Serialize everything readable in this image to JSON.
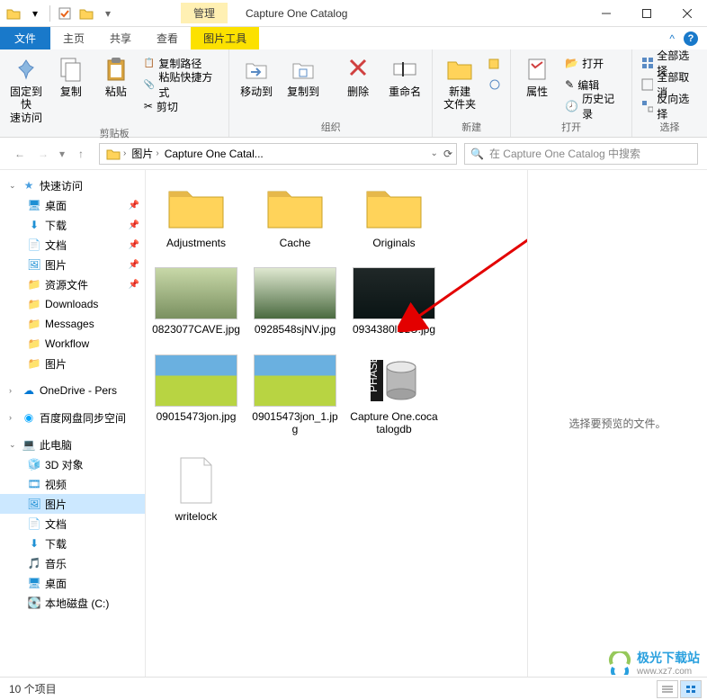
{
  "window": {
    "title": "Capture One Catalog",
    "context_tab": "管理"
  },
  "tabs": {
    "file": "文件",
    "home": "主页",
    "share": "共享",
    "view": "查看",
    "picture_tools": "图片工具"
  },
  "ribbon": {
    "pin_to_quick": "固定到快\n速访问",
    "copy": "复制",
    "paste": "粘贴",
    "copy_path": "复制路径",
    "paste_shortcut": "粘贴快捷方式",
    "cut": "剪切",
    "clipboard_group": "剪贴板",
    "move_to": "移动到",
    "copy_to": "复制到",
    "delete": "删除",
    "rename": "重命名",
    "organize_group": "组织",
    "new_folder": "新建\n文件夹",
    "new_group": "新建",
    "properties": "属性",
    "open": "打开",
    "edit": "编辑",
    "history": "历史记录",
    "open_group": "打开",
    "select_all": "全部选择",
    "select_none": "全部取消",
    "invert_selection": "反向选择",
    "select_group": "选择"
  },
  "breadcrumb": {
    "seg1": "图片",
    "seg2": "Capture One Catal..."
  },
  "search": {
    "placeholder": "在 Capture One Catalog 中搜索"
  },
  "nav": {
    "quick_access": "快速访问",
    "desktop": "桌面",
    "downloads": "下载",
    "documents": "文档",
    "pictures": "图片",
    "resources": "资源文件",
    "downloads_en": "Downloads",
    "messages": "Messages",
    "workflow": "Workflow",
    "pictures2": "图片",
    "onedrive": "OneDrive - Pers",
    "baidu": "百度网盘同步空间",
    "this_pc": "此电脑",
    "objects_3d": "3D 对象",
    "videos": "视频",
    "pictures3": "图片",
    "documents2": "文档",
    "downloads2": "下载",
    "music": "音乐",
    "desktop2": "桌面",
    "local_disk": "本地磁盘 (C:)"
  },
  "files": {
    "folder1": "Adjustments",
    "folder2": "Cache",
    "folder3": "Originals",
    "img1": "0823077CAVE.jpg",
    "img2": "0928548sjNV.jpg",
    "img3": "0934380lCzU.jpg",
    "img4": "09015473jon.jpg",
    "img5": "09015473jon_1.jpg",
    "db": "Capture One.cocatalogdb",
    "lock": "writelock"
  },
  "preview": {
    "text": "选择要预览的文件。"
  },
  "status": {
    "count": "10 个项目"
  },
  "watermark": {
    "text": "极光下载站",
    "url": "www.xz7.com"
  },
  "colors": {
    "folder": "#ffd35a",
    "blue": "#1979ca"
  }
}
